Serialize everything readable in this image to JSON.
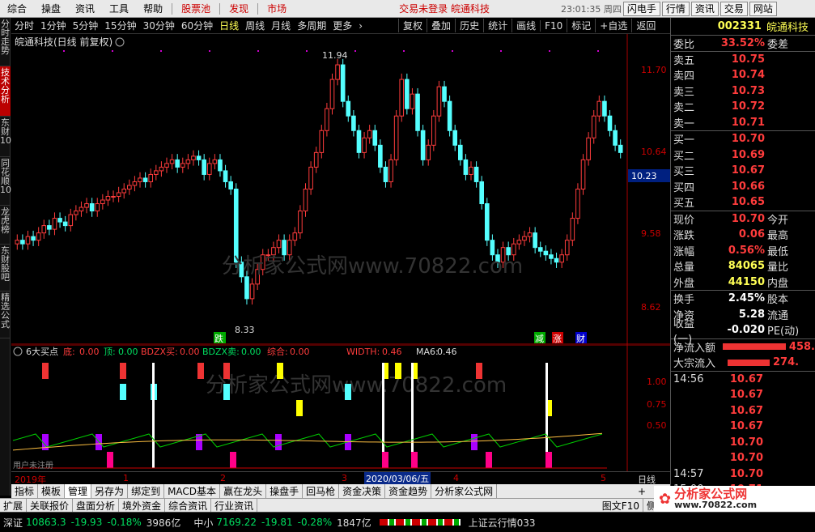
{
  "menubar": {
    "items": [
      "综合",
      "操盘",
      "资讯",
      "工具",
      "帮助"
    ],
    "red_items": [
      "股票池",
      "发现",
      "市场"
    ],
    "app_title": "交易未登录 皖通科技",
    "clock": "23:01:35 周四",
    "right_buttons": [
      "闪电手",
      "行情",
      "资讯",
      "交易",
      "网站"
    ]
  },
  "left_tabs": [
    "分时走势",
    "技术分析",
    "东财10",
    "同花顺10",
    "龙虎榜",
    "东财股吧",
    "精选公式"
  ],
  "periodbar": {
    "periods": [
      "分时",
      "1分钟",
      "5分钟",
      "15分钟",
      "30分钟",
      "60分钟",
      "日线",
      "周线",
      "月线",
      "多周期",
      "更多"
    ],
    "active": "日线",
    "tools": [
      "复权",
      "叠加",
      "历史",
      "统计",
      "画线",
      "F10",
      "标记",
      "+自选",
      "返回"
    ]
  },
  "main_chart": {
    "title": "皖通科技(日线 前复权)",
    "price_labels": [
      "11.70",
      "10.64",
      "9.58",
      "8.62"
    ],
    "current_price_tag": "10.23",
    "high_label": "11.94",
    "low_label": "8.33",
    "watermark": "分析家公式网www.70822.com",
    "markers": {
      "die": "跌",
      "jian": "减",
      "zhang": "涨",
      "cai": "财"
    }
  },
  "indicator": {
    "name": "6大买点",
    "params": [
      {
        "label": "底:",
        "value": "0.00"
      },
      {
        "label": "顶:",
        "value": "0.00"
      },
      {
        "label": "BDZX买:",
        "value": "0.00"
      },
      {
        "label": "BDZX卖:",
        "value": "0.00"
      },
      {
        "label": "综合:",
        "value": "0.00"
      },
      {
        "label": "WIDTH:",
        "value": "0.46"
      },
      {
        "label": "MA6:",
        "value": "0.46"
      }
    ],
    "axis_labels": [
      "1.00",
      "0.75",
      "0.50"
    ],
    "watermark": "分析家公式网www.70822.com",
    "footer_text": "用户未注册"
  },
  "xaxis": {
    "labels": [
      "2019年",
      "1",
      "2",
      "3",
      "2020/03/06/五",
      "4",
      "5"
    ],
    "period": "日线"
  },
  "bottom_tabs": [
    "指标",
    "模板",
    "管理",
    "另存为",
    "绑定到",
    "MACD基本",
    "赢在龙头",
    "操盘手",
    "回马枪",
    "资金决策",
    "资金趋势",
    "分析家公式网"
  ],
  "row2_tabs": [
    "扩展",
    "关联报价",
    "盘面分析",
    "境外资金",
    "综合资讯",
    "行业资讯"
  ],
  "row2_right": [
    "图文F10",
    "侧边"
  ],
  "rightpanel": {
    "code": "002331",
    "name": "皖通科技",
    "wei_bi": "33.52%",
    "wei_cha_label": "委差",
    "sells": [
      {
        "label": "卖五",
        "price": "10.75"
      },
      {
        "label": "卖四",
        "price": "10.74"
      },
      {
        "label": "卖三",
        "price": "10.73"
      },
      {
        "label": "卖二",
        "price": "10.72"
      },
      {
        "label": "卖一",
        "price": "10.71"
      }
    ],
    "buys": [
      {
        "label": "买一",
        "price": "10.70"
      },
      {
        "label": "买二",
        "price": "10.69"
      },
      {
        "label": "买三",
        "price": "10.67"
      },
      {
        "label": "买四",
        "price": "10.66"
      },
      {
        "label": "买五",
        "price": "10.65"
      }
    ],
    "quotes": [
      {
        "l": "现价",
        "v": "10.70",
        "r": "今开"
      },
      {
        "l": "涨跌",
        "v": "0.06",
        "r": "最高"
      },
      {
        "l": "涨幅",
        "v": "0.56%",
        "r": "最低"
      },
      {
        "l": "总量",
        "v": "84065",
        "r": "量比"
      },
      {
        "l": "外盘",
        "v": "44150",
        "r": "内盘"
      }
    ],
    "stats": [
      {
        "l": "换手",
        "v": "2.45%",
        "r": "股本"
      },
      {
        "l": "净资",
        "v": "5.28",
        "r": "流通"
      },
      {
        "l": "收益(一)",
        "v": "-0.020",
        "r": "PE(动)"
      }
    ],
    "flows": [
      {
        "l": "净流入额",
        "v": "458."
      },
      {
        "l": "大宗流入",
        "v": "274."
      }
    ],
    "ticks": [
      {
        "t": "14:56",
        "p": "10.67"
      },
      {
        "t": "",
        "p": "10.67"
      },
      {
        "t": "",
        "p": "10.67"
      },
      {
        "t": "",
        "p": "10.67"
      },
      {
        "t": "",
        "p": "10.70"
      },
      {
        "t": "",
        "p": "10.70"
      },
      {
        "t": "14:57",
        "p": "10.70"
      },
      {
        "t": "15:00",
        "p": "10.71"
      }
    ]
  },
  "statusbar": {
    "shenzheng_label": "深证",
    "shenzheng": "10863.3",
    "sz_chg": "-19.93",
    "sz_pct": "-0.18%",
    "sz_amt": "3986亿",
    "zx_label": "中小",
    "zx": "7169.22",
    "zx_chg": "-19.81",
    "zx_pct": "-0.28%",
    "zx_amt": "1847亿",
    "msg": "上证云行情033",
    "logo_text": "分析家公式网",
    "logo_url": "www.70822.com"
  }
}
